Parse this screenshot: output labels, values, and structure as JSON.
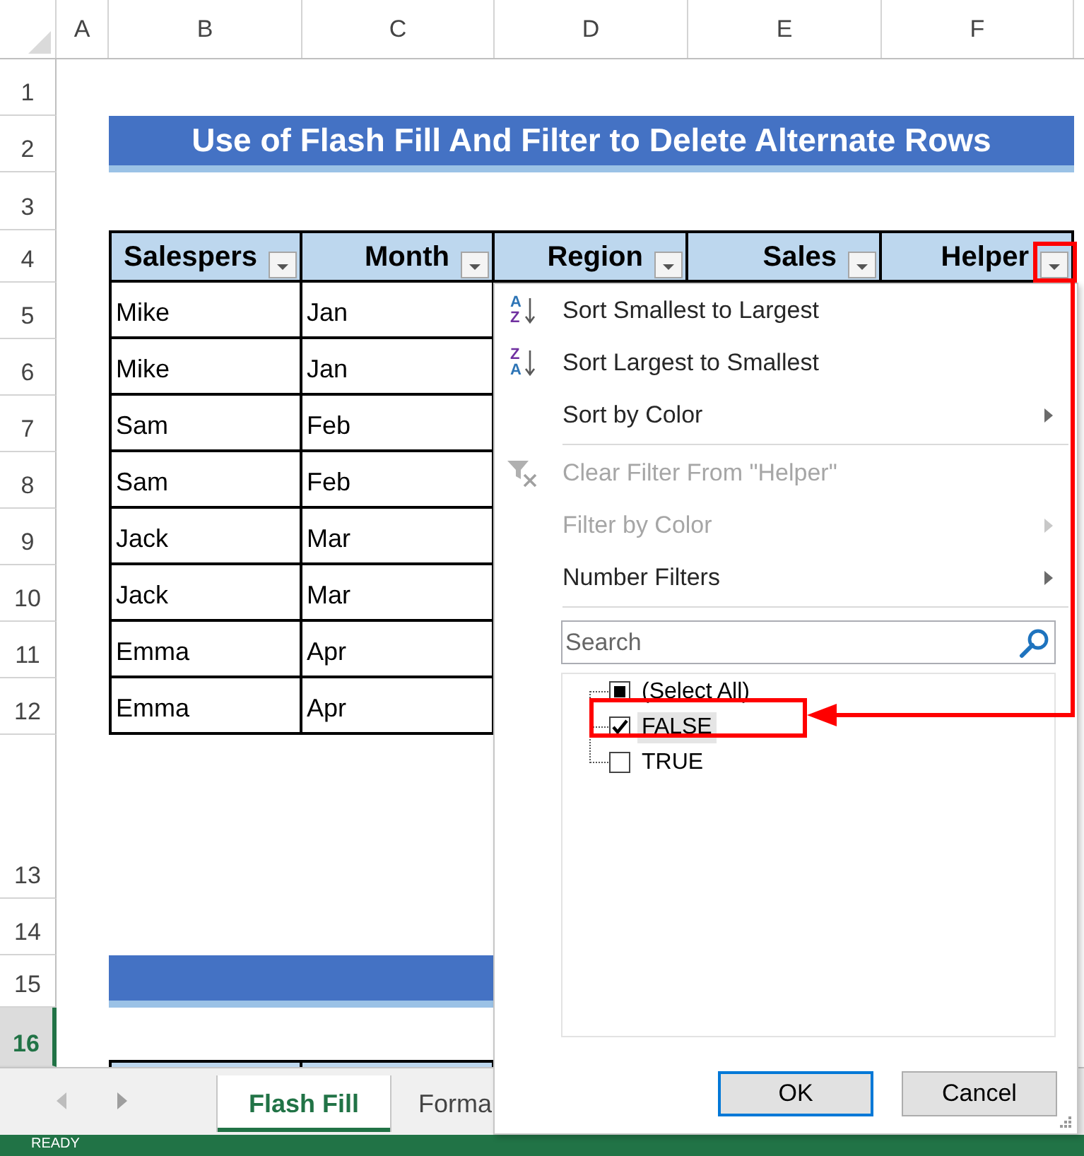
{
  "sheet": {
    "columns": [
      "A",
      "B",
      "C",
      "D",
      "E",
      "F"
    ],
    "rows": [
      {
        "label": "1",
        "selected": false
      },
      {
        "label": "2",
        "selected": false
      },
      {
        "label": "3",
        "selected": false
      },
      {
        "label": "4",
        "selected": false
      },
      {
        "label": "5",
        "selected": false
      },
      {
        "label": "6",
        "selected": false
      },
      {
        "label": "7",
        "selected": false
      },
      {
        "label": "8",
        "selected": false
      },
      {
        "label": "9",
        "selected": false
      },
      {
        "label": "10",
        "selected": false
      },
      {
        "label": "11",
        "selected": false
      },
      {
        "label": "12",
        "selected": false
      },
      {
        "label": "13",
        "selected": false
      },
      {
        "label": "14",
        "selected": false
      },
      {
        "label": "15",
        "selected": false
      },
      {
        "label": "16",
        "selected": true
      }
    ]
  },
  "title": "Use of Flash Fill And Filter to Delete Alternate Rows",
  "table": {
    "columns": [
      "Salespers",
      "Month",
      "Region",
      "Sales",
      "Helper"
    ],
    "rows": [
      [
        "Mike",
        "Jan"
      ],
      [
        "Mike",
        "Jan"
      ],
      [
        "Sam",
        "Feb"
      ],
      [
        "Sam",
        "Feb"
      ],
      [
        "Jack",
        "Mar"
      ],
      [
        "Jack",
        "Mar"
      ],
      [
        "Emma",
        "Apr"
      ],
      [
        "Emma",
        "Apr"
      ]
    ]
  },
  "filter_menu": {
    "groups": [
      [
        {
          "label": "Sort Smallest to Largest",
          "kind": "ascending",
          "icon_letters": [
            "A",
            "Z"
          ],
          "disabled": false,
          "submenu": false
        },
        {
          "label": "Sort Largest to Smallest",
          "kind": "descending",
          "icon_letters": [
            "Z",
            "A"
          ],
          "disabled": false,
          "submenu": false
        },
        {
          "label": "Sort by Color",
          "kind": "plain",
          "disabled": false,
          "submenu": true
        }
      ],
      [
        {
          "label": "Clear Filter From \"Helper\"",
          "kind": "clear",
          "disabled": true,
          "submenu": false
        },
        {
          "label": "Filter by Color",
          "kind": "plain",
          "disabled": true,
          "submenu": true
        },
        {
          "label": "Number Filters",
          "kind": "plain",
          "disabled": false,
          "submenu": true
        }
      ]
    ],
    "search": {
      "placeholder": "Search"
    },
    "values": [
      {
        "label": "(Select All)",
        "checked": false,
        "partial": true,
        "focused": false
      },
      {
        "label": "FALSE",
        "checked": true,
        "partial": false,
        "focused": true
      },
      {
        "label": "TRUE",
        "checked": false,
        "partial": false,
        "focused": false
      }
    ],
    "buttons": [
      {
        "label": "OK",
        "default": true
      },
      {
        "label": "Cancel",
        "default": false
      }
    ]
  },
  "sheet_tabs": [
    {
      "label": "Flash Fill",
      "selected": true
    },
    {
      "label": "Forma",
      "selected": false
    }
  ],
  "status_bar": {
    "text": "READY"
  }
}
